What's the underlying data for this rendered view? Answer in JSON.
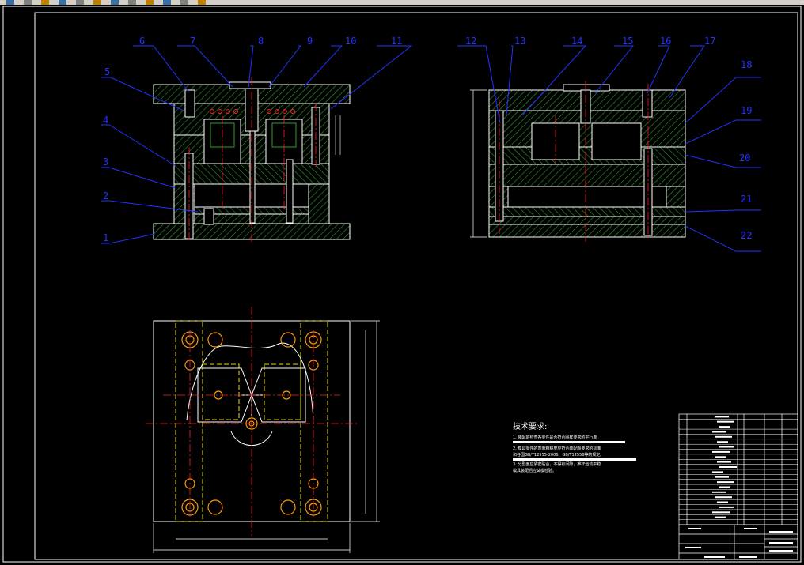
{
  "colors": {
    "background": "#000000",
    "frame": "#ffffff",
    "plate": "#ffffff",
    "hatch": "#2f9e2f",
    "leader": "#2233ff",
    "label": "#2233ff",
    "center": "#ff2020",
    "hidden": "#e8e000",
    "dimension": "#ffffff",
    "orange": "#ff9900"
  },
  "toolbar": {
    "icons": [
      "open-icon",
      "save-icon",
      "print-icon",
      "cut-icon",
      "copy-icon",
      "paste-icon",
      "undo-icon",
      "redo-icon",
      "zoom-icon",
      "pan-icon",
      "layer-icon",
      "properties-icon"
    ]
  },
  "labels_left": [
    "1",
    "2",
    "3",
    "4",
    "5",
    "6",
    "7",
    "8",
    "9",
    "10",
    "11"
  ],
  "labels_right": [
    "12",
    "13",
    "14",
    "15",
    "16",
    "17",
    "18",
    "19",
    "20",
    "21",
    "22"
  ],
  "tech_requirements": {
    "title": "技术要求:",
    "lines": [
      "1. 装配前检查各零件是否符合图样要求的平行度",
      "2. 模具零件的表面粗糙度应符合装配图要求的标准",
      "和各国GB/T12555-2006、GB/T12556等的规定。",
      "3. 分型面应紧密贴合，不得有间隙，推杆运动平稳",
      "模具装配后应试模检验。"
    ]
  }
}
